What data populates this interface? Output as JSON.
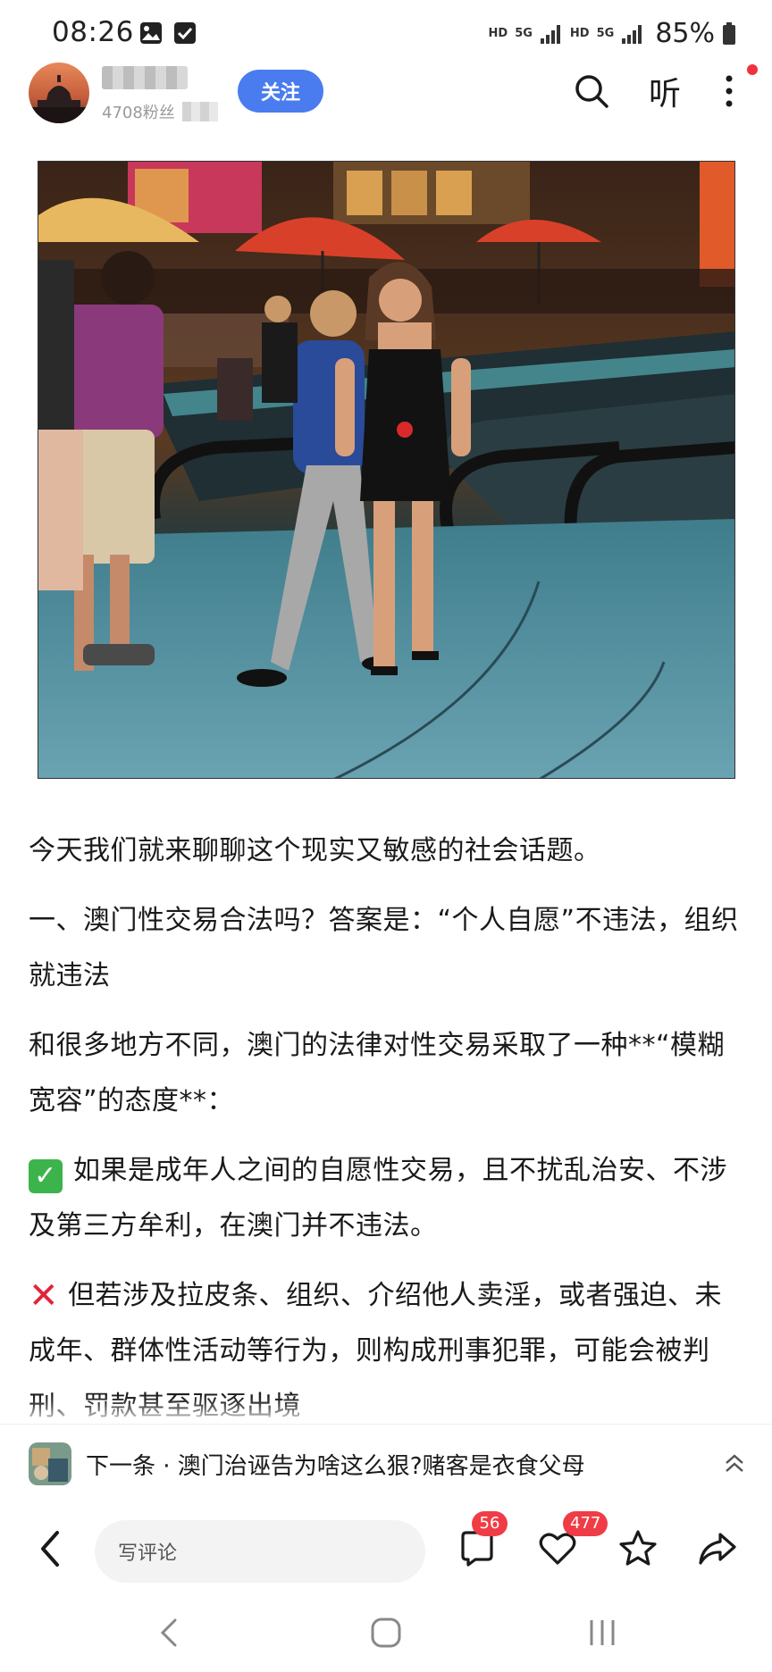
{
  "status_bar": {
    "time": "08:26",
    "network_1": "HD",
    "network_2": "5G",
    "network_3": "HD",
    "network_4": "5G",
    "battery": "85%"
  },
  "header": {
    "follower_count": "4708粉丝",
    "follow_label": "关注",
    "listen_label": "听"
  },
  "article": {
    "paragraphs": [
      "今天我们就来聊聊这个现实又敏感的社会话题。",
      "一、澳门性交易合法吗？答案是：“个人自愿”不违法，组织就违法",
      "和很多地方不同，澳门的法律对性交易采取了一种**“模糊宽容”的态度**：",
      "如果是成年人之间的自愿性交易，且不扰乱治安、不涉及第三方牟利，在澳门并不违法。",
      "但若涉及拉皮条、组织、介绍他人卖淫，或者强迫、未成年、群体性活动等行为，则构成刑事犯罪，可能会被判刑、罚款甚至驱逐出境"
    ]
  },
  "next_item": {
    "label": "下一条 · 澳门治诬告为啥这么狠?赌客是衣食父母"
  },
  "toolbar": {
    "comment_placeholder": "写评论",
    "comment_count": "56",
    "like_count": "477"
  },
  "colors": {
    "accent": "#4a7cf0",
    "badge": "#f03c46",
    "check": "#3cb44b",
    "cross": "#e2243a"
  },
  "icons": [
    "image-icon",
    "checkbox-icon",
    "signal-icon",
    "battery-icon",
    "search-icon",
    "more-icon",
    "back-icon",
    "comment-icon",
    "heart-icon",
    "star-icon",
    "share-icon",
    "chevron-up-icon",
    "nav-back-icon",
    "nav-home-icon",
    "nav-recents-icon"
  ]
}
